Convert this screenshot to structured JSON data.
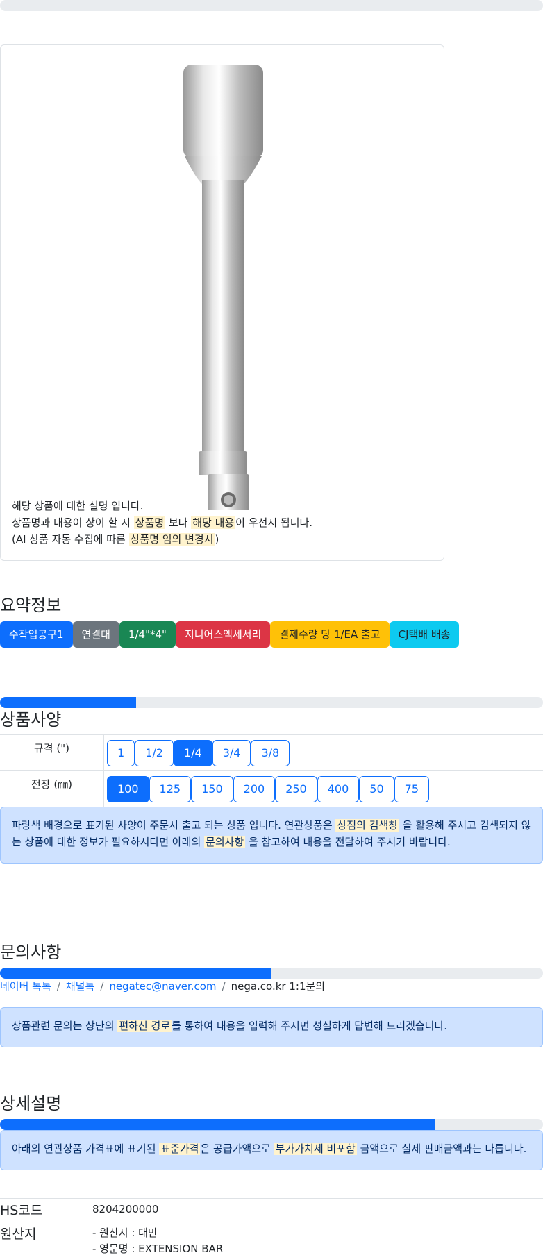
{
  "product": {
    "desc_line1": "해당 상품에 대한 설명 입니다.",
    "desc_line2_a": "상품명과 내용이 상이 할 시 ",
    "desc_line2_hl1": "상품명",
    "desc_line2_b": " 보다 ",
    "desc_line2_hl2": "해당 내용",
    "desc_line2_c": "이 우선시 됩니다.",
    "desc_line3_a": "(AI 상품 자동 수집에 따른 ",
    "desc_line3_hl": "상품명 임의 변경시",
    "desc_line3_b": ")"
  },
  "summary": {
    "title": "요약정보",
    "badges": [
      {
        "label": "수작업공구1",
        "color": "#0d6efd",
        "text_color": "#ffffff"
      },
      {
        "label": "연결대",
        "color": "#6c757d",
        "text_color": "#ffffff"
      },
      {
        "label": "1/4\"*4\"",
        "color": "#198754",
        "text_color": "#ffffff"
      },
      {
        "label": "지니어스액세서리",
        "color": "#dc3545",
        "text_color": "#ffffff"
      },
      {
        "label": "결제수량 당 1/EA 출고",
        "color": "#ffc107",
        "text_color": "#212529"
      },
      {
        "label": "CJ택배 배송",
        "color": "#0dcaf0",
        "text_color": "#212529"
      }
    ]
  },
  "specs": {
    "title": "상품사양",
    "progress": 0.25,
    "rows": [
      {
        "label": "규격 (\")",
        "options": [
          "1",
          "1/2",
          "1/4",
          "3/4",
          "3/8"
        ],
        "selected": "1/4"
      },
      {
        "label": "전장 (㎜)",
        "options": [
          "100",
          "125",
          "150",
          "200",
          "250",
          "400",
          "50",
          "75"
        ],
        "selected": "100"
      }
    ],
    "notice_a": "파랑색 배경으로 표기된 사양이 주문시 출고 되는 상품 입니다. 연관상품은 ",
    "notice_hl1": "상점의 검색창",
    "notice_b": " 을 활용해 주시고 검색되지 않는 상품에 대한 정보가 필요하시다면 아래의 ",
    "notice_hl2": "문의사항",
    "notice_c": " 을 참고하여 내용을 전달하여 주시기 바랍니다."
  },
  "inquiry": {
    "title": "문의사항",
    "progress": 0.5,
    "links": [
      "네이버 톡톡",
      "채널톡",
      "negatec@naver.com"
    ],
    "plain": "nega.co.kr 1:1문의",
    "notice_a": "상품관련 문의는 상단의 ",
    "notice_hl": "편하신 경로",
    "notice_b": "를 통하여 내용을 입력해 주시면 성실하게 답변해 드리겠습니다."
  },
  "detail": {
    "title": "상세설명",
    "progress": 0.8,
    "notice_a": "아래의 연관상품 가격표에 표기된 ",
    "notice_hl1": "표준가격",
    "notice_b": "은 공급가액으로 ",
    "notice_hl2": "부가가치세 비포함",
    "notice_c": " 금액으로 실제 판매금액과는 다릅니다.",
    "hs_label": "HS코드",
    "hs_value": "8204200000",
    "origin_label": "원산지",
    "origin_line1": "- 원산지 : 대만",
    "origin_line2": "- 영문명 : EXTENSION BAR"
  },
  "top_progress": 0
}
